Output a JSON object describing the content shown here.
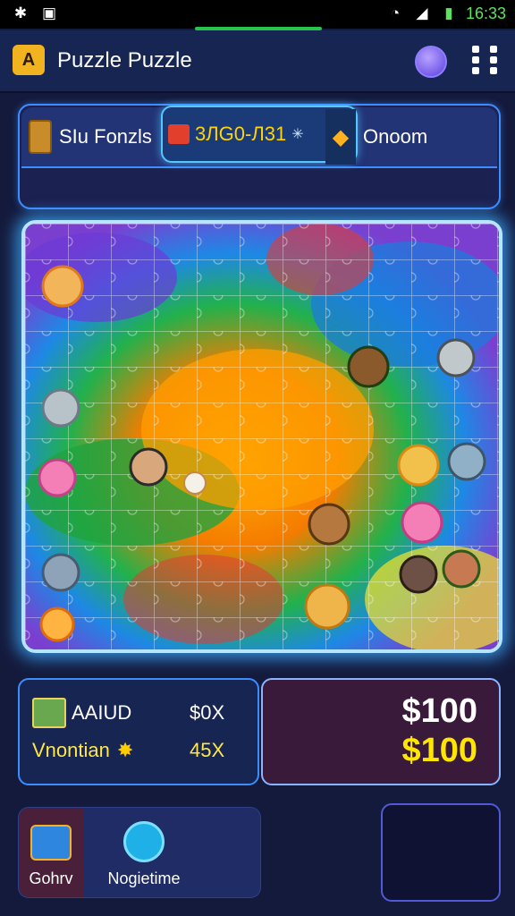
{
  "status_bar": {
    "time": "16:33",
    "icons": [
      "bluetooth-icon",
      "image-icon",
      "wifi-icon",
      "signal-icon",
      "battery-icon"
    ]
  },
  "app": {
    "title": "Puzzle Puzzle",
    "logo_glyph": "A"
  },
  "tabs": [
    {
      "label": "SIu Fonzls",
      "icon": "box-icon"
    },
    {
      "label": "3ЛG0-Л31",
      "icon": "flag-icon",
      "active": true
    },
    {
      "label": "Onoom",
      "icon": "gem-icon"
    }
  ],
  "stats": {
    "row1_label": "AAIUD",
    "row1_value": "$0X",
    "row2_label": "Vnontian",
    "row2_value": "45X"
  },
  "prices": {
    "price_top": "$100",
    "price_bottom": "$100"
  },
  "nav": {
    "item1_label": "Gohrv",
    "item2_label": "Nogietime"
  },
  "colors": {
    "accent_blue": "#3d8dff",
    "gold": "#ffe600",
    "bg": "#141a3c"
  }
}
